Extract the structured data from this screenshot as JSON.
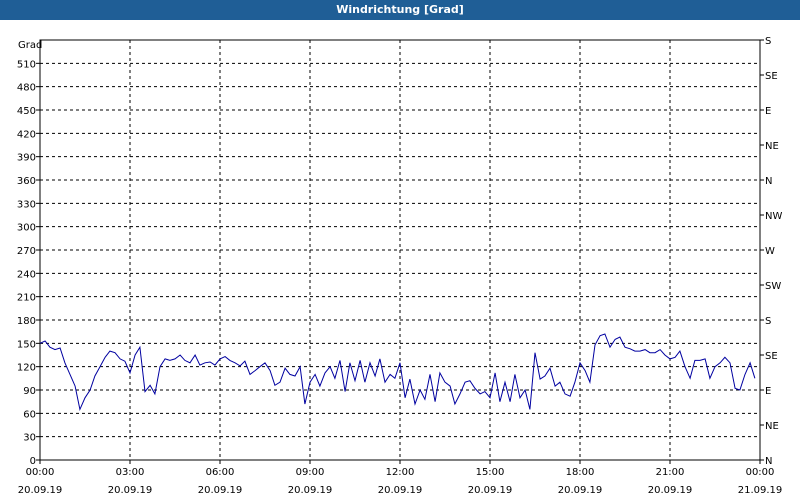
{
  "window": {
    "title": "Windrichtung [Grad]"
  },
  "chart_data": {
    "type": "line",
    "title": "Windrichtung [Grad]",
    "ylabel": "Grad",
    "ylim": [
      0,
      540
    ],
    "yticks": [
      0,
      30,
      60,
      90,
      120,
      150,
      180,
      210,
      240,
      270,
      300,
      330,
      360,
      390,
      420,
      450,
      480,
      510
    ],
    "right_axis_labels": [
      {
        "value": 0,
        "label": "N"
      },
      {
        "value": 45,
        "label": "NE"
      },
      {
        "value": 90,
        "label": "E"
      },
      {
        "value": 135,
        "label": "SE"
      },
      {
        "value": 180,
        "label": "S"
      },
      {
        "value": 225,
        "label": "SW"
      },
      {
        "value": 270,
        "label": "W"
      },
      {
        "value": 315,
        "label": "NW"
      },
      {
        "value": 360,
        "label": "N"
      },
      {
        "value": 405,
        "label": "NE"
      },
      {
        "value": 450,
        "label": "E"
      },
      {
        "value": 495,
        "label": "SE"
      },
      {
        "value": 540,
        "label": "S"
      }
    ],
    "x_ticks": [
      {
        "time": "00:00",
        "date": "20.09.19"
      },
      {
        "time": "03:00",
        "date": "20.09.19"
      },
      {
        "time": "06:00",
        "date": "20.09.19"
      },
      {
        "time": "09:00",
        "date": "20.09.19"
      },
      {
        "time": "12:00",
        "date": "20.09.19"
      },
      {
        "time": "15:00",
        "date": "20.09.19"
      },
      {
        "time": "18:00",
        "date": "20.09.19"
      },
      {
        "time": "21:00",
        "date": "20.09.19"
      },
      {
        "time": "00:00",
        "date": "21.09.19"
      }
    ],
    "x_range_hours": [
      0,
      24
    ],
    "grid": true,
    "line_color": "#0000a0",
    "series": [
      {
        "x": [
          0.0,
          0.17,
          0.33,
          0.5,
          0.67,
          0.83,
          1.0,
          1.17,
          1.33,
          1.5,
          1.67,
          1.83,
          2.0,
          2.17,
          2.33,
          2.5,
          2.67,
          2.83,
          3.0,
          3.17,
          3.33,
          3.5,
          3.67,
          3.83,
          4.0,
          4.17,
          4.33,
          4.5,
          4.67,
          4.83,
          5.0,
          5.17,
          5.33,
          5.5,
          5.67,
          5.83,
          6.0,
          6.17,
          6.33,
          6.5,
          6.67,
          6.83,
          7.0,
          7.17,
          7.33,
          7.5,
          7.67,
          7.83,
          8.0,
          8.17,
          8.33,
          8.5,
          8.67,
          8.83,
          9.0,
          9.17,
          9.33,
          9.5,
          9.67,
          9.83,
          10.0,
          10.17,
          10.33,
          10.5,
          10.67,
          10.83,
          11.0,
          11.17,
          11.33,
          11.5,
          11.67,
          11.83,
          12.0,
          12.17,
          12.33,
          12.5,
          12.67,
          12.83,
          13.0,
          13.17,
          13.33,
          13.5,
          13.67,
          13.83,
          14.0,
          14.17,
          14.33,
          14.5,
          14.67,
          14.83,
          15.0,
          15.17,
          15.33,
          15.5,
          15.67,
          15.83,
          16.0,
          16.17,
          16.33,
          16.5,
          16.67,
          16.83,
          17.0,
          17.17,
          17.33,
          17.5,
          17.67,
          17.83,
          18.0,
          18.17,
          18.33,
          18.5,
          18.67,
          18.83,
          19.0,
          19.17,
          19.33,
          19.5,
          19.67,
          19.83,
          20.0,
          20.17,
          20.33,
          20.5,
          20.67,
          20.83,
          21.0,
          21.17,
          21.33,
          21.5,
          21.67,
          21.83,
          22.0,
          22.17,
          22.33,
          22.5,
          22.67,
          22.83,
          23.0,
          23.17,
          23.33,
          23.5,
          23.67,
          23.83
        ],
        "values": [
          150,
          153,
          145,
          142,
          144,
          125,
          110,
          95,
          65,
          80,
          90,
          108,
          120,
          132,
          140,
          138,
          130,
          127,
          112,
          135,
          145,
          88,
          96,
          85,
          120,
          130,
          128,
          130,
          135,
          128,
          125,
          135,
          122,
          125,
          126,
          122,
          130,
          133,
          128,
          125,
          121,
          127,
          110,
          115,
          120,
          125,
          115,
          96,
          100,
          118,
          110,
          108,
          120,
          72,
          100,
          110,
          95,
          112,
          120,
          105,
          128,
          88,
          125,
          102,
          128,
          100,
          125,
          108,
          130,
          100,
          110,
          105,
          125,
          80,
          104,
          72,
          90,
          78,
          110,
          75,
          112,
          100,
          95,
          72,
          85,
          100,
          102,
          92,
          85,
          88,
          80,
          112,
          75,
          100,
          75,
          110,
          80,
          90,
          65,
          138,
          104,
          108,
          118,
          95,
          100,
          85,
          82,
          100,
          125,
          115,
          100,
          148,
          160,
          162,
          145,
          155,
          158,
          145,
          143,
          140,
          140,
          142,
          138,
          138,
          142,
          135,
          130,
          132,
          140,
          120,
          105,
          128,
          128,
          130,
          105,
          120,
          125,
          132,
          125,
          92,
          90,
          110,
          125,
          105
        ]
      }
    ]
  }
}
